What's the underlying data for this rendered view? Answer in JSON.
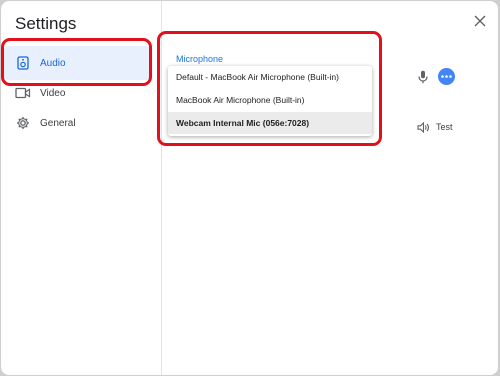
{
  "dialog": {
    "title": "Settings"
  },
  "sidebar": {
    "items": [
      {
        "label": "Audio",
        "icon": "speaker-icon",
        "selected": true
      },
      {
        "label": "Video",
        "icon": "video-camera-icon",
        "selected": false
      },
      {
        "label": "General",
        "icon": "gear-icon",
        "selected": false
      }
    ]
  },
  "audio": {
    "section_label": "Microphone",
    "microphone_options": [
      "Default - MacBook Air Microphone (Built-in)",
      "MacBook Air Microphone (Built-in)",
      "Webcam Internal Mic (056e:7028)"
    ],
    "highlighted_option_index": 2,
    "test_label": "Test"
  },
  "colors": {
    "accent": "#1a73e8",
    "selected_bg": "#e8f0fe",
    "highlight_border": "#e3101b",
    "more_button": "#4285f4"
  }
}
